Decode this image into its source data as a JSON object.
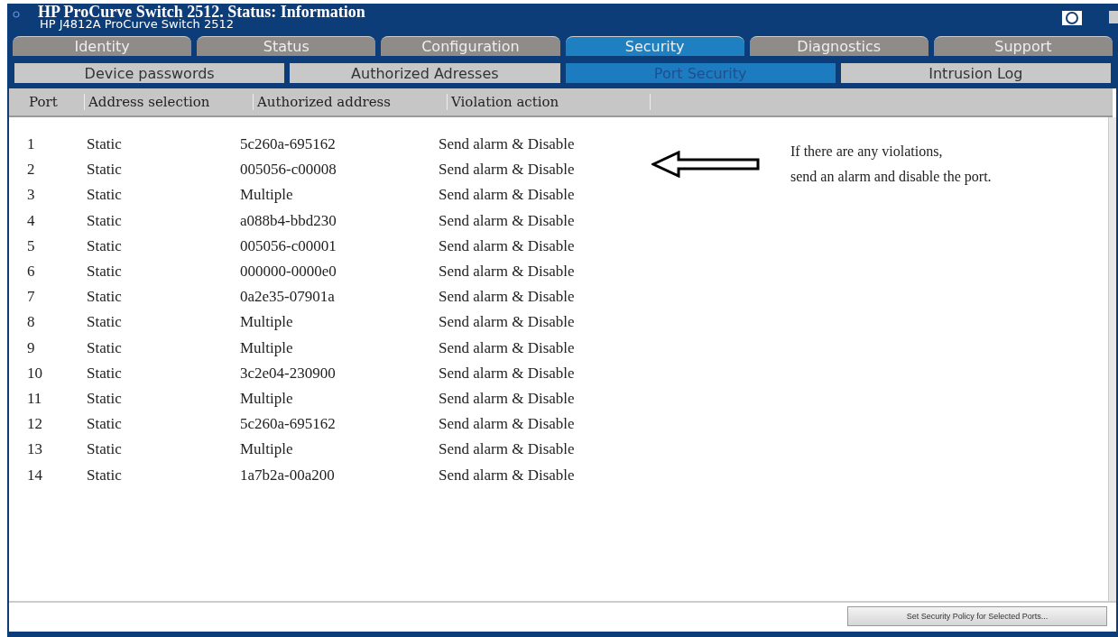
{
  "window": {
    "title": "HP ProCurve Switch 2512. Status: Information",
    "subtitle": "HP J4812A ProCurve Switch 2512"
  },
  "tabs": [
    {
      "label": "Identity",
      "selected": false
    },
    {
      "label": "Status",
      "selected": false
    },
    {
      "label": "Configuration",
      "selected": false
    },
    {
      "label": "Security",
      "selected": true
    },
    {
      "label": "Diagnostics",
      "selected": false
    },
    {
      "label": "Support",
      "selected": false
    }
  ],
  "subtabs": [
    {
      "label": "Device passwords",
      "selected": false
    },
    {
      "label": "Authorized Adresses",
      "selected": false
    },
    {
      "label": "Port Security",
      "selected": true
    },
    {
      "label": "Intrusion Log",
      "selected": false
    }
  ],
  "table": {
    "columns": [
      "Port",
      "Address selection",
      "Authorized address",
      "Violation action"
    ],
    "rows": [
      [
        "1",
        "Static",
        "5c260a-695162",
        "Send alarm & Disable"
      ],
      [
        "2",
        "Static",
        "005056-c00008",
        "Send alarm & Disable"
      ],
      [
        "3",
        "Static",
        "Multiple",
        "Send alarm & Disable"
      ],
      [
        "4",
        "Static",
        "a088b4-bbd230",
        "Send alarm & Disable"
      ],
      [
        "5",
        "Static",
        "005056-c00001",
        "Send alarm & Disable"
      ],
      [
        "6",
        "Static",
        "000000-0000e0",
        "Send alarm & Disable"
      ],
      [
        "7",
        "Static",
        "0a2e35-07901a",
        "Send alarm & Disable"
      ],
      [
        "8",
        "Static",
        "Multiple",
        "Send alarm & Disable"
      ],
      [
        "9",
        "Static",
        "Multiple",
        "Send alarm & Disable"
      ],
      [
        "10",
        "Static",
        "3c2e04-230900",
        "Send alarm & Disable"
      ],
      [
        "11",
        "Static",
        "Multiple",
        "Send alarm & Disable"
      ],
      [
        "12",
        "Static",
        "5c260a-695162",
        "Send alarm & Disable"
      ],
      [
        "13",
        "Static",
        "Multiple",
        "Send alarm & Disable"
      ],
      [
        "14",
        "Static",
        "1a7b2a-00a200",
        "Send alarm & Disable"
      ]
    ]
  },
  "annotation": [
    "If there are any violations,",
    "send an alarm and disable the port."
  ],
  "button": "Set Security Policy for Selected Ports..."
}
